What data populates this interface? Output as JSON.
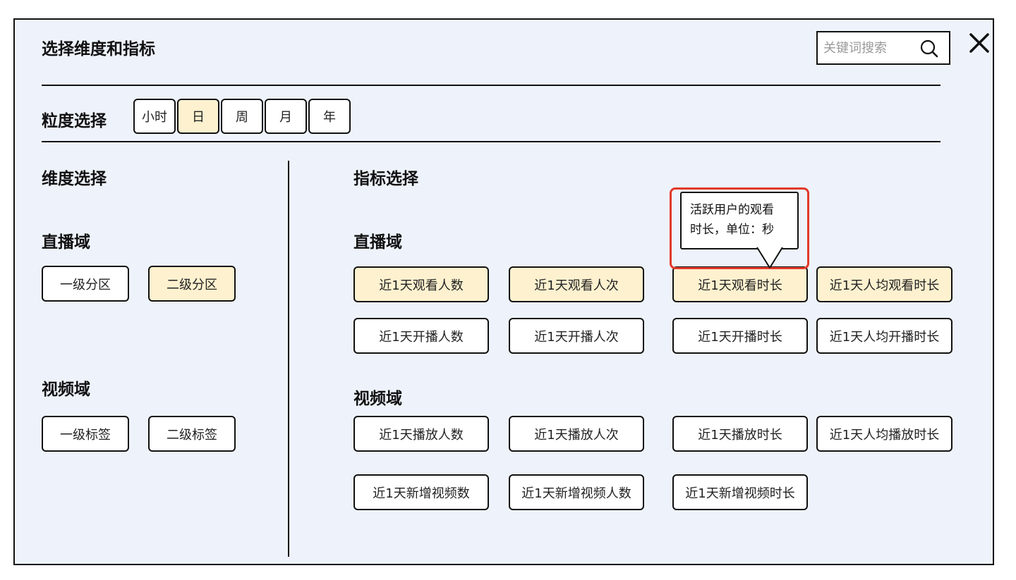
{
  "dialog": {
    "title": "选择维度和指标",
    "search": {
      "placeholder": "关键词搜索",
      "value": ""
    }
  },
  "granularity": {
    "label": "粒度选择",
    "options": [
      "小时",
      "日",
      "周",
      "月",
      "年"
    ],
    "selected": "日"
  },
  "dimension": {
    "title": "维度选择",
    "live": {
      "label": "直播域",
      "items": [
        "一级分区",
        "二级分区"
      ],
      "selected": [
        "二级分区"
      ]
    },
    "video": {
      "label": "视频域",
      "items": [
        "一级标签",
        "二级标签"
      ],
      "selected": []
    }
  },
  "metric": {
    "title": "指标选择",
    "live": {
      "label": "直播域",
      "items": [
        "近1天观看人数",
        "近1天观看人次",
        "近1天观看时长",
        "近1天人均观看时长",
        "近1天开播人数",
        "近1天开播人次",
        "近1天开播时长",
        "近1天人均开播时长"
      ],
      "selected": [
        "近1天观看人数",
        "近1天观看人次",
        "近1天观看时长",
        "近1天人均观看时长"
      ]
    },
    "video": {
      "label": "视频域",
      "items": [
        "近1天播放人数",
        "近1天播放人次",
        "近1天播放时长",
        "近1天人均播放时长",
        "近1天新增视频数",
        "近1天新增视频人数",
        "近1天新增视频时长"
      ],
      "selected": []
    }
  },
  "tooltip": {
    "line1": "活跃用户的观看",
    "line2": "时长，单位：秒"
  },
  "colors": {
    "panel_bg": "#eef3fb",
    "selected_bg": "#fdf1cf",
    "highlight_border": "#e3392b"
  }
}
